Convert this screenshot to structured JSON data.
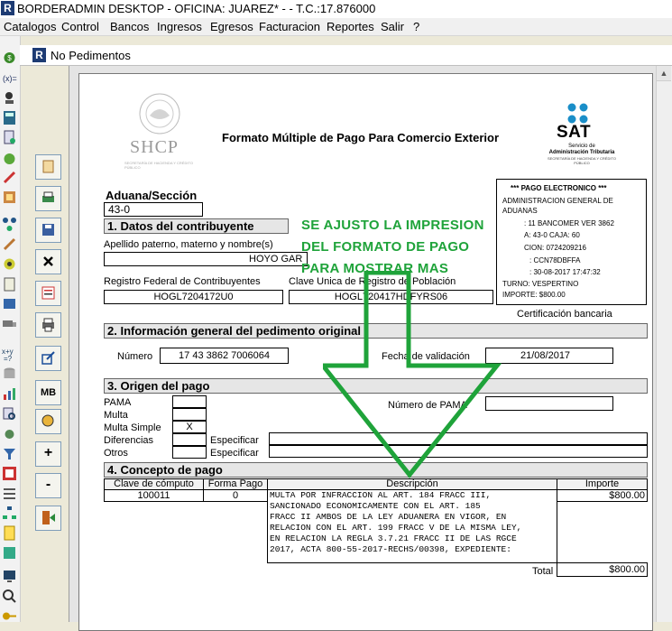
{
  "window": {
    "title": "BORDERADMIN DESKTOP - OFICINA: JUAREZ* -  - T.C.:17.876000"
  },
  "menu": [
    "Catalogos",
    "Control",
    "Bancos",
    "Ingresos",
    "Egresos",
    "Facturacion",
    "Reportes",
    "Salir",
    "?"
  ],
  "child_window": {
    "title": "No Pedimentos"
  },
  "toolbar": {
    "mb_label": "MB",
    "plus_label": "+",
    "minus_label": "-"
  },
  "form": {
    "title": "Formato Múltiple de Pago Para Comercio Exterior",
    "shcp": {
      "logo_text": "SHCP",
      "sub": "SECRETARÍA DE HACIENDA Y CRÉDITO PÚBLICO"
    },
    "sat": {
      "logo_text": "SAT",
      "line1": "Servicio de",
      "line2": "Administración Tributaria",
      "line3": "SECRETARÍA DE HACIENDA Y CRÉDITO PÚBLICO"
    },
    "aduana_label": "Aduana/Sección",
    "aduana_value": "43-0",
    "sec1": "1. Datos del contribuyente",
    "nombre_label": "Apellido paterno, materno y nombre(s)",
    "nombre_value": "HOYO GAR",
    "rfc_label": "Registro Federal de Contribuyentes",
    "rfc_value": "HOGL7204172U0",
    "curp_label": "Clave Unica de Registro de Población",
    "curp_value": "HOGL720417HDFYRS06",
    "pago": {
      "header": "*** PAGO ELECTRONICO ***",
      "line1": "ADMINISTRACION GENERAL DE",
      "line2": "ADUANAS",
      "line3": ": 11 BANCOMER VER 3862",
      "line4": "A: 43-0  CAJA: 60",
      "line5": "CION: 0724209216",
      "line6": ": CCN78DBFFA",
      "line7": ": 30-08-2017 17:47:32",
      "turno": "TURNO: VESPERTINO",
      "importe": "IMPORTE: $800.00"
    },
    "certificacion": "Certificación bancaria",
    "sec2": "2. Información general del pedimento original",
    "numero_label": "Número",
    "numero_value": "17 43 3862 7006064",
    "fecha_label": "Fecha de validación",
    "fecha_value": "21/08/2017",
    "sec3": "3. Origen del pago",
    "pama_label": "PAMA",
    "multa_label": "Multa",
    "multa_simple_label": "Multa Simple",
    "multa_simple_value": "X",
    "diferencias_label": "Diferencias",
    "otros_label": "Otros",
    "especificar1": "Especificar",
    "especificar2": "Especificar",
    "num_pama_label": "Número de PAMA",
    "sec4": "4. Concepto de pago",
    "cols": [
      "Clave de cómputo",
      "Forma Pago",
      "Descripción",
      "Importe"
    ],
    "row": {
      "clave": "100011",
      "forma": "0",
      "desc": [
        "MULTA POR INFRACCION AL ART. 184 FRACC III,",
        "SANCIONADO ECONOMICAMENTE CON EL ART. 185",
        "FRACC II AMBOS DE LA LEY ADUANERA EN VIGOR, EN",
        "RELACION CON EL ART. 199 FRACC V DE LA MISMA LEY,",
        "EN RELACION LA REGLA 3.7.21 FRACC II DE LAS RGCE",
        "2017, ACTA 800-55-2017-RECHS/00398, EXPEDIENTE:"
      ],
      "importe": "$800.00"
    },
    "total_label": "Total",
    "total_value": "$800.00"
  },
  "annotation": {
    "line1": "SE AJUSTO LA IMPRESION",
    "line2": "DEL FORMATO DE PAGO",
    "line3": "PARA MOSTRAR MAS",
    "color": "#1fa33a"
  }
}
